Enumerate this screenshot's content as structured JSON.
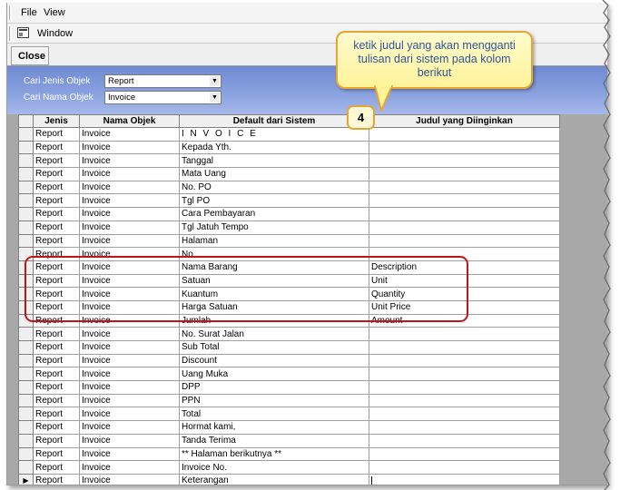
{
  "menu": {
    "file": "File",
    "view": "View",
    "window": "Window"
  },
  "toolbar": {
    "close_label": "Close"
  },
  "filters": {
    "jenis_label": "Cari Jenis Objek",
    "jenis_value": "Report",
    "nama_label": "Cari Nama Objek",
    "nama_value": "Invoice"
  },
  "grid": {
    "headers": [
      "Jenis",
      "Nama Objek",
      "Default dari Sistem",
      "Judul yang Diinginkan"
    ],
    "rows": [
      [
        "Report",
        "Invoice",
        "I N V O I C E",
        ""
      ],
      [
        "Report",
        "Invoice",
        "Kepada Yth.",
        ""
      ],
      [
        "Report",
        "Invoice",
        "Tanggal",
        ""
      ],
      [
        "Report",
        "Invoice",
        "Mata Uang",
        ""
      ],
      [
        "Report",
        "Invoice",
        "No. PO",
        ""
      ],
      [
        "Report",
        "Invoice",
        "Tgl PO",
        ""
      ],
      [
        "Report",
        "Invoice",
        "Cara Pembayaran",
        ""
      ],
      [
        "Report",
        "Invoice",
        "Tgl Jatuh Tempo",
        ""
      ],
      [
        "Report",
        "Invoice",
        "Halaman",
        ""
      ],
      [
        "Report",
        "Invoice",
        "No.",
        ""
      ],
      [
        "Report",
        "Invoice",
        "Nama Barang",
        "Description"
      ],
      [
        "Report",
        "Invoice",
        "Satuan",
        "Unit"
      ],
      [
        "Report",
        "Invoice",
        "Kuantum",
        "Quantity"
      ],
      [
        "Report",
        "Invoice",
        "Harga Satuan",
        "Unit Price"
      ],
      [
        "Report",
        "Invoice",
        "Jumlah",
        "Amount"
      ],
      [
        "Report",
        "Invoice",
        "No. Surat Jalan",
        ""
      ],
      [
        "Report",
        "Invoice",
        "Sub Total",
        ""
      ],
      [
        "Report",
        "Invoice",
        "Discount",
        ""
      ],
      [
        "Report",
        "Invoice",
        "Uang Muka",
        ""
      ],
      [
        "Report",
        "Invoice",
        "DPP",
        ""
      ],
      [
        "Report",
        "Invoice",
        "PPN",
        ""
      ],
      [
        "Report",
        "Invoice",
        "Total",
        ""
      ],
      [
        "Report",
        "Invoice",
        "Hormat kami,",
        ""
      ],
      [
        "Report",
        "Invoice",
        "Tanda Terima",
        ""
      ],
      [
        "Report",
        "Invoice",
        "** Halaman berikutnya **",
        ""
      ],
      [
        "Report",
        "Invoice",
        "Invoice No.",
        ""
      ],
      [
        "Report",
        "Invoice",
        "Keterangan",
        ""
      ]
    ],
    "current_row_marker": "▶"
  },
  "callout": {
    "text": "ketik judul yang akan mengganti tulisan dari sistem pada kolom berikut",
    "step": "4"
  },
  "colors": {
    "filter_panel": "#7f98da",
    "highlight_border": "#c0141c",
    "callout_text": "#2f5597",
    "callout_border": "#e5a533"
  }
}
